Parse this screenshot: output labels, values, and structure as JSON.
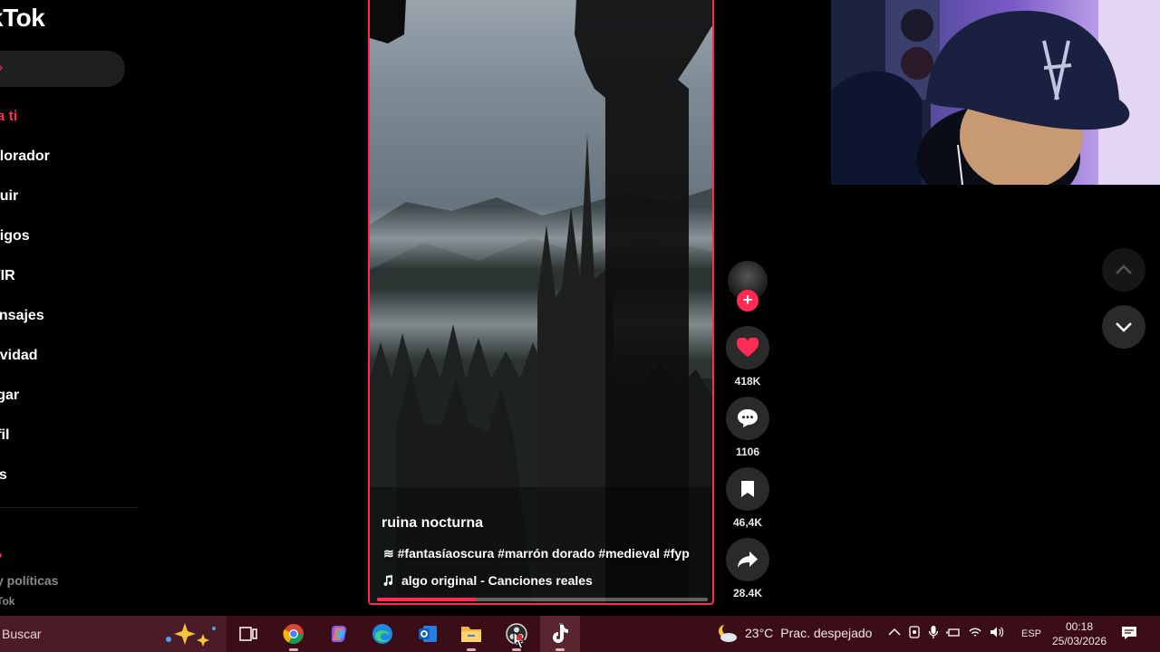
{
  "sidebar": {
    "logo": "kTok",
    "nav": [
      {
        "label": "ra ti",
        "active": true
      },
      {
        "label": "plorador"
      },
      {
        "label": "guir"
      },
      {
        "label": "nigos"
      },
      {
        "label": "VIR"
      },
      {
        "label": "ensajes"
      },
      {
        "label": "tividad"
      },
      {
        "label": "rgar"
      },
      {
        "label": "rfil"
      },
      {
        "label": "ás"
      }
    ],
    "footer_policies": "y políticas",
    "footer_copy": "Tok"
  },
  "video": {
    "title": "ruina nocturna",
    "tags": "≋ #fantasíaoscura #marrón dorado #medieval #fyp",
    "music": "algo original - Canciones reales",
    "progress": 0.3
  },
  "actions": {
    "follow_symbol": "+",
    "likes": "418K",
    "comments": "1106",
    "saves": "46,4K",
    "shares": "28.4K"
  },
  "taskbar": {
    "search_label": "Buscar",
    "weather_temp": "23°C",
    "weather_desc": "Prac. despejado",
    "lang": "ESP",
    "time": "00:18",
    "date": "25/03/2026"
  },
  "colors": {
    "accent": "#fe2c55",
    "taskbar": "#3b0d16"
  }
}
